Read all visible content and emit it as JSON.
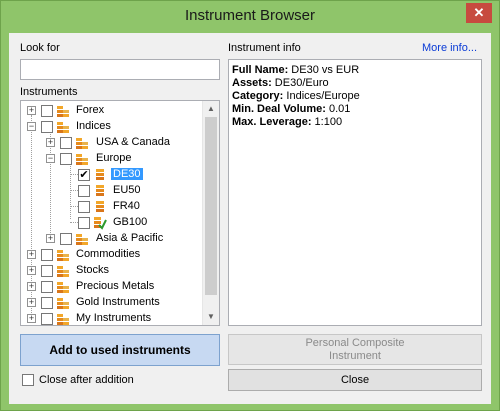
{
  "window": {
    "title": "Instrument Browser",
    "close_glyph": "✕"
  },
  "search": {
    "label": "Look for",
    "value": "",
    "placeholder": ""
  },
  "tree": {
    "label": "Instruments",
    "nodes": [
      {
        "label": "Forex",
        "expander": "+",
        "checked": false
      },
      {
        "label": "Indices",
        "expander": "−",
        "checked": false
      },
      {
        "label": "USA & Canada",
        "expander": "+",
        "checked": false
      },
      {
        "label": "Europe",
        "expander": "−",
        "checked": false
      },
      {
        "label": "DE30",
        "checked": true,
        "selected": true
      },
      {
        "label": "EU50",
        "checked": false
      },
      {
        "label": "FR40",
        "checked": false
      },
      {
        "label": "GB100",
        "checked": false
      },
      {
        "label": "Asia & Pacific",
        "expander": "+",
        "checked": false
      },
      {
        "label": "Commodities",
        "expander": "+",
        "checked": false
      },
      {
        "label": "Stocks",
        "expander": "+",
        "checked": false
      },
      {
        "label": "Precious Metals",
        "expander": "+",
        "checked": false
      },
      {
        "label": "Gold Instruments",
        "expander": "+",
        "checked": false
      },
      {
        "label": "My Instruments",
        "expander": "+",
        "checked": false
      }
    ],
    "check_glyph": "✔",
    "scroll_up_glyph": "▲",
    "scroll_down_glyph": "▼"
  },
  "info": {
    "label": "Instrument info",
    "more_link": "More info...",
    "fields": [
      {
        "key": "Full Name:",
        "value": " DE30 vs EUR"
      },
      {
        "key": "Assets:",
        "value": " DE30/Euro"
      },
      {
        "key": "Category:",
        "value": " Indices/Europe"
      },
      {
        "key": "Min. Deal Volume:",
        "value": " 0.01"
      },
      {
        "key": "Max. Leverage:",
        "value": " 1:100"
      }
    ]
  },
  "buttons": {
    "add": "Add to used instruments",
    "composite_line1": "Personal Composite",
    "composite_line2": "Instrument",
    "close": "Close"
  },
  "close_after": {
    "label": "Close after addition",
    "checked": false
  },
  "colors": {
    "frame": "#8fc56a",
    "selection": "#3399ff",
    "link": "#0a3bd6",
    "add_button": "#c7d9f2"
  }
}
